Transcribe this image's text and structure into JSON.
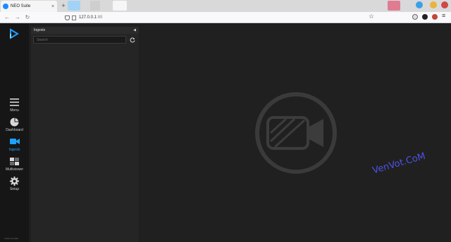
{
  "browser": {
    "tab": {
      "title": "NEO Suite",
      "close_glyph": "×"
    },
    "new_tab_glyph": "+",
    "url": {
      "host": "127.0.0.1",
      "path": ":89"
    },
    "nav": {
      "back": "←",
      "forward": "→",
      "reload": "↻"
    },
    "star_glyph": "☆",
    "menu_glyph": "≡",
    "colors": {
      "tabstrip": "#d9d9d9",
      "toolbar": "#f9f9fb"
    }
  },
  "app": {
    "accent": "#1ea0ff",
    "rail": {
      "items": [
        {
          "label": "Menu",
          "icon": "menu-icon",
          "active": false
        },
        {
          "label": "Dashboard",
          "icon": "dashboard-pie-icon",
          "active": false
        },
        {
          "label": "Ingests",
          "icon": "ingest-camera-icon",
          "active": true
        },
        {
          "label": "Multiviewer",
          "icon": "multiviewer-grid-icon",
          "active": false
        },
        {
          "label": "Setup",
          "icon": "gear-icon",
          "active": false
        }
      ],
      "version": "v2019.03.0099"
    },
    "panel": {
      "title": "Ingests",
      "collapse_glyph": "◀",
      "search": {
        "placeholder": "Search",
        "value": ""
      }
    },
    "viewer": {
      "placeholder_icon": "camera-placeholder-icon"
    }
  },
  "watermark": "VenVot.CoM"
}
